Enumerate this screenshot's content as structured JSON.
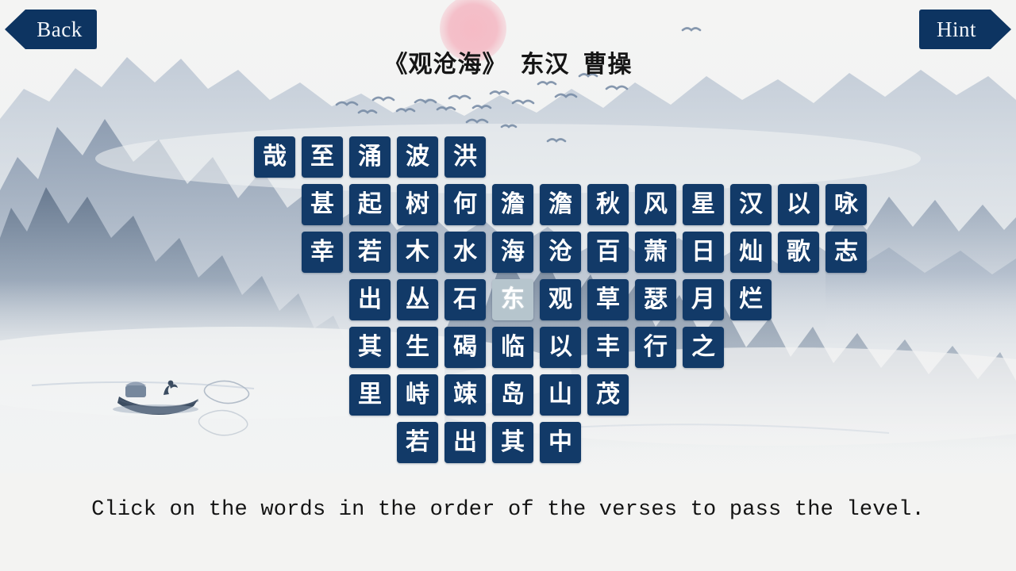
{
  "window": {
    "title": "《观沧海》 东汉 曹操"
  },
  "nav": {
    "back_label": "Back",
    "hint_label": "Hint"
  },
  "header": {
    "title": "《观沧海》  东汉  曹操"
  },
  "footer": {
    "instruction": "Click on the words in the order of the verses to pass the level."
  },
  "colors": {
    "tile_background": "#123a68",
    "tile_text": "#ffffff",
    "tile_selected_background": "#b6c5cd",
    "button_background": "#0d3461",
    "button_text": "#f3f6fa",
    "page_background": "#f2f2f0",
    "sun": "#f4b4c0",
    "mountain_dark": "#6c7f96",
    "mountain_light": "#c3cdd9"
  },
  "grid": {
    "columns": 12,
    "selected_tile": "东",
    "rows": [
      {
        "offset": 0,
        "tiles": [
          "哉",
          "至",
          "涌",
          "波",
          "洪"
        ]
      },
      {
        "offset": 1,
        "tiles": [
          "甚",
          "起",
          "树",
          "何",
          "澹",
          "澹",
          "秋",
          "风",
          "星",
          "汉",
          "以",
          "咏"
        ]
      },
      {
        "offset": 1,
        "tiles": [
          "幸",
          "若",
          "木",
          "水",
          "海",
          "沧",
          "百",
          "萧",
          "日",
          "灿",
          "歌",
          "志"
        ]
      },
      {
        "offset": 2,
        "tiles": [
          "出",
          "丛",
          "石",
          "东",
          "观",
          "草",
          "瑟",
          "月",
          "烂"
        ]
      },
      {
        "offset": 2,
        "tiles": [
          "其",
          "生",
          "碣",
          "临",
          "以",
          "丰",
          "行",
          "之"
        ]
      },
      {
        "offset": 2,
        "tiles": [
          "里",
          "峙",
          "竦",
          "岛",
          "山",
          "茂"
        ]
      },
      {
        "offset": 3,
        "tiles": [
          "若",
          "出",
          "其",
          "中"
        ]
      }
    ]
  }
}
